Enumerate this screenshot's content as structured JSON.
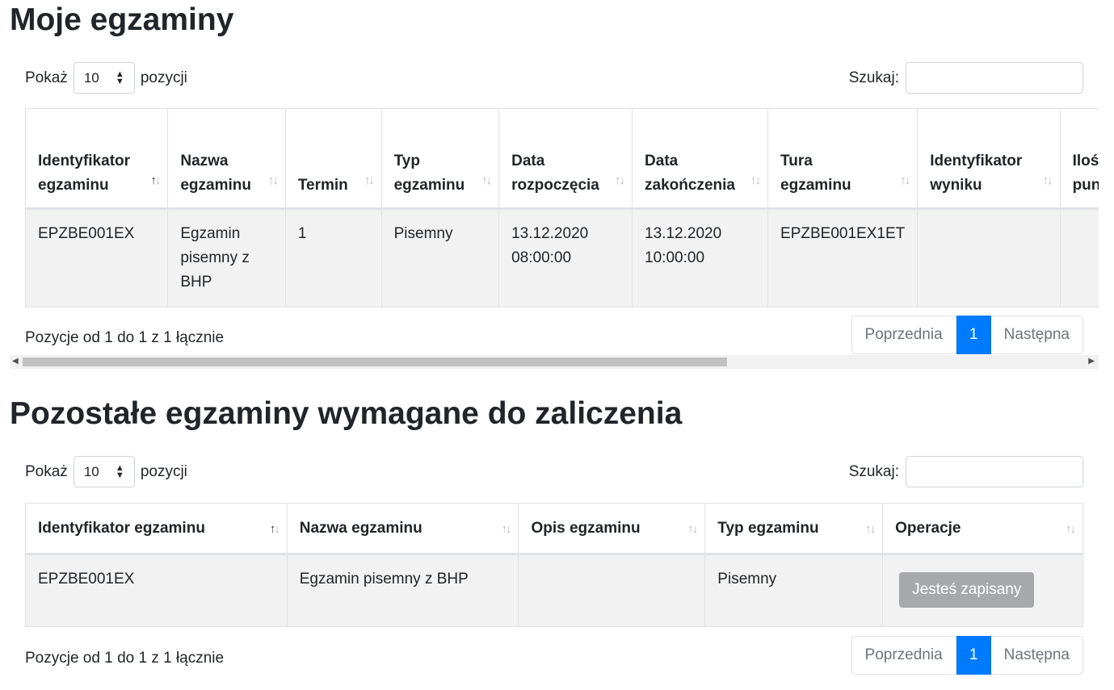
{
  "sections": [
    {
      "title": "Moje egzaminy",
      "show_label": "Pokaż",
      "show_value": "10",
      "show_suffix": "pozycji",
      "search_label": "Szukaj:",
      "columns": [
        "Identyfikator egzaminu",
        "Nazwa egzaminu",
        "Termin",
        "Typ egzaminu",
        "Data rozpoczęcia",
        "Data zakończenia",
        "Tura egzaminu",
        "Identyfikator wyniku",
        "Ilość punk"
      ],
      "rows": [
        [
          "EPZBE001EX",
          "Egzamin pisemny z BHP",
          "1",
          "Pisemny",
          "13.12.2020 08:00:00",
          "13.12.2020 10:00:00",
          "EPZBE001EX1ET",
          "",
          ""
        ]
      ],
      "info": "Pozycje od 1 do 1 z 1 łącznie",
      "pager": {
        "prev": "Poprzednia",
        "current": "1",
        "next": "Następna"
      }
    },
    {
      "title": "Pozostałe egzaminy wymagane do zaliczenia",
      "show_label": "Pokaż",
      "show_value": "10",
      "show_suffix": "pozycji",
      "search_label": "Szukaj:",
      "columns": [
        "Identyfikator egzaminu",
        "Nazwa egzaminu",
        "Opis egzaminu",
        "Typ egzaminu",
        "Operacje"
      ],
      "rows": [
        [
          "EPZBE001EX",
          "Egzamin pisemny z BHP",
          "",
          "Pisemny",
          ""
        ]
      ],
      "enrolled_button": "Jesteś zapisany",
      "info": "Pozycje od 1 do 1 z 1 łącznie",
      "pager": {
        "prev": "Poprzednia",
        "current": "1",
        "next": "Następna"
      }
    }
  ],
  "sort_icon": "sort-arrows-icon",
  "colors": {
    "accent": "#007bff",
    "disabled_button": "#a6a8ab",
    "row_bg": "#f2f2f2"
  }
}
